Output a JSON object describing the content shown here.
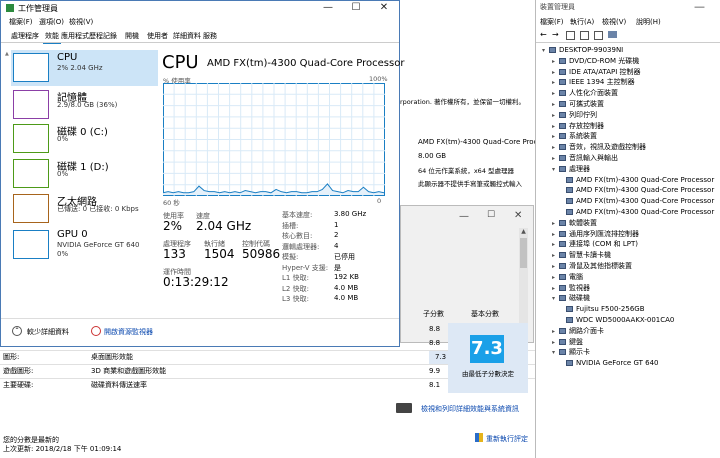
{
  "bg": {
    "texts": [
      "rporation. 著作權所有，並保留一切權利。",
      "AMD FX(tm)-4300 Quad-Core Processor",
      "8.00 GB",
      "64 位元作業系統，x64 型處理器",
      "此顯示器不提供手寫筆或觸控式輸入"
    ],
    "score_header": "子分數",
    "base_header": "基本分數",
    "rows": [
      {
        "label": "",
        "desc": "",
        "score": "8.8"
      },
      {
        "label": "",
        "desc": "",
        "score": "8.8"
      },
      {
        "label": "圖形:",
        "desc": "桌面圖形效能",
        "score": "7.3"
      },
      {
        "label": "遊戲圖形:",
        "desc": "3D 商業和遊戲圖形效能",
        "score": "9.9"
      },
      {
        "label": "主要硬碟:",
        "desc": "磁碟資料傳送速率",
        "score": "8.1"
      }
    ],
    "base_score": "7.3",
    "base_caption": "由最低子分數決定",
    "print_link": "檢視和列印詳細效能與系統資訊",
    "status1": "您的分數是最新的",
    "status2": "上次更新: 2018/2/18 下午 01:09:14",
    "rerun": "重新執行評定"
  },
  "devmgr": {
    "menu": [
      "檔案(F)",
      "執行(A)",
      "檢視(V)",
      "說明(H)"
    ],
    "title": "裝置管理員",
    "items": [
      {
        "label": "DESKTOP-99039NI",
        "level": 0,
        "exp": "⌄"
      },
      {
        "label": "DVD/CD-ROM 光碟機",
        "level": 1,
        "exp": "›"
      },
      {
        "label": "IDE ATA/ATAPI 控制器",
        "level": 1,
        "exp": "›"
      },
      {
        "label": "IEEE 1394 主控制器",
        "level": 1,
        "exp": "›"
      },
      {
        "label": "人性化介面裝置",
        "level": 1,
        "exp": "›"
      },
      {
        "label": "可攜式裝置",
        "level": 1,
        "exp": "›"
      },
      {
        "label": "列印佇列",
        "level": 1,
        "exp": "›"
      },
      {
        "label": "存放控制器",
        "level": 1,
        "exp": "›"
      },
      {
        "label": "系統裝置",
        "level": 1,
        "exp": "›"
      },
      {
        "label": "音效，視訊及遊戲控制器",
        "level": 1,
        "exp": "›"
      },
      {
        "label": "音訊輸入與輸出",
        "level": 1,
        "exp": "›"
      },
      {
        "label": "處理器",
        "level": 1,
        "exp": "⌄"
      },
      {
        "label": "AMD FX(tm)-4300 Quad-Core Processor",
        "level": 2,
        "exp": ""
      },
      {
        "label": "AMD FX(tm)-4300 Quad-Core Processor",
        "level": 2,
        "exp": ""
      },
      {
        "label": "AMD FX(tm)-4300 Quad-Core Processor",
        "level": 2,
        "exp": ""
      },
      {
        "label": "AMD FX(tm)-4300 Quad-Core Processor",
        "level": 2,
        "exp": ""
      },
      {
        "label": "軟體裝置",
        "level": 1,
        "exp": "›"
      },
      {
        "label": "通用序列匯流排控制器",
        "level": 1,
        "exp": "›"
      },
      {
        "label": "連接埠 (COM 和 LPT)",
        "level": 1,
        "exp": "›"
      },
      {
        "label": "智慧卡讀卡機",
        "level": 1,
        "exp": "›"
      },
      {
        "label": "滑鼠及其他指標裝置",
        "level": 1,
        "exp": "›"
      },
      {
        "label": "電腦",
        "level": 1,
        "exp": "›"
      },
      {
        "label": "監視器",
        "level": 1,
        "exp": "›"
      },
      {
        "label": "磁碟機",
        "level": 1,
        "exp": "⌄"
      },
      {
        "label": "Fujitsu F500-256GB",
        "level": 2,
        "exp": ""
      },
      {
        "label": "WDC WD5000AAKX-001CA0",
        "level": 2,
        "exp": ""
      },
      {
        "label": "網路介面卡",
        "level": 1,
        "exp": "›"
      },
      {
        "label": "鍵盤",
        "level": 1,
        "exp": "›"
      },
      {
        "label": "顯示卡",
        "level": 1,
        "exp": "⌄"
      },
      {
        "label": "NVIDIA GeForce GT 640",
        "level": 2,
        "exp": ""
      }
    ]
  },
  "tm": {
    "title": "工作管理員",
    "menu": [
      "檔案(F)",
      "選項(O)",
      "檢視(V)"
    ],
    "tabs": [
      "處理程序",
      "效能",
      "應用程式歷程記錄",
      "開機",
      "使用者",
      "詳細資料",
      "服務"
    ],
    "active_tab": 1,
    "sidebar": [
      {
        "title": "CPU",
        "sub": "2% 2.04 GHz",
        "color": "#1a7fc4",
        "selected": true
      },
      {
        "title": "記憶體",
        "sub": "2.9/8.0 GB (36%)",
        "color": "#8b3fa6",
        "selected": false
      },
      {
        "title": "磁碟 0 (C:)",
        "sub": "0%",
        "color": "#4d9a18",
        "selected": false
      },
      {
        "title": "磁碟 1 (D:)",
        "sub": "0%",
        "color": "#4d9a18",
        "selected": false
      },
      {
        "title": "乙太網路",
        "sub": "已傳送: 0 已接收: 0 Kbps",
        "color": "#a7641c",
        "selected": false
      },
      {
        "title": "GPU 0",
        "sub": "NVIDIA GeForce GT 640",
        "sub2": "0%",
        "color": "#1a7fc4",
        "selected": false
      }
    ],
    "heading": "CPU",
    "model": "AMD FX(tm)-4300 Quad-Core Processor",
    "graph_label": "% 使用率",
    "graph_max": "100%",
    "graph_time": "60 秒",
    "graph_min": "0",
    "graph_values": [
      2,
      3,
      2,
      3,
      2,
      2,
      3,
      8,
      4,
      3,
      3,
      2,
      3,
      2,
      3,
      2,
      4,
      3,
      2,
      3,
      3,
      2,
      5,
      3,
      2,
      3,
      3,
      2,
      2,
      3,
      3,
      5,
      10,
      4,
      3,
      2,
      4,
      3,
      3,
      7,
      3,
      2,
      3,
      2
    ],
    "stats": {
      "usage_label": "使用率",
      "usage": "2%",
      "speed_label": "速度",
      "speed": "2.04 GHz",
      "proc_label": "處理程序",
      "proc": "133",
      "threads_label": "執行緒",
      "threads": "1504",
      "handles_label": "控制代碼",
      "handles": "50986",
      "uptime_label": "運作時間",
      "uptime": "0:13:29:12"
    },
    "details": [
      {
        "k": "基本速度:",
        "v": "3.80 GHz"
      },
      {
        "k": "插槽:",
        "v": "1"
      },
      {
        "k": "核心數目:",
        "v": "2"
      },
      {
        "k": "邏輯處理器:",
        "v": "4"
      },
      {
        "k": "模擬:",
        "v": "已停用"
      },
      {
        "k": "Hyper-V 支援:",
        "v": "是"
      },
      {
        "k": "L1 快取:",
        "v": "192 KB"
      },
      {
        "k": "L2 快取:",
        "v": "4.0 MB"
      },
      {
        "k": "L3 快取:",
        "v": "4.0 MB"
      }
    ],
    "fewer": "較少詳細資料",
    "resmon": "開啟資源監視器"
  }
}
